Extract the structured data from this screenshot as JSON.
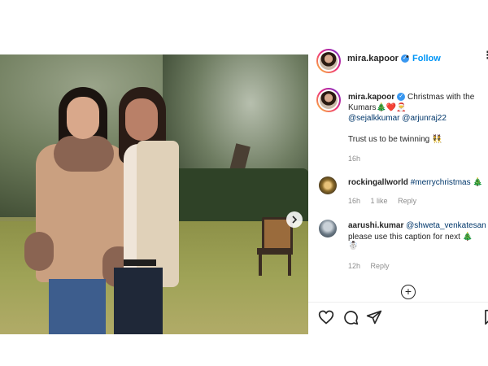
{
  "post": {
    "username": "mira.kapoor",
    "follow_label": "Follow",
    "separator": "•"
  },
  "caption": {
    "username": "mira.kapoor",
    "text": "Christmas with the Kumars",
    "emojis": "🎄❤️🎅",
    "mentions": [
      "@sejalkkumar",
      "@arjunraj22"
    ],
    "line2": "Trust us to be twinning 👯",
    "time": "16h"
  },
  "comments": [
    {
      "username": "rockingallworld",
      "text": "#merrychristmas 🎄",
      "time": "16h",
      "likes": "1 like",
      "reply": "Reply"
    },
    {
      "username": "aarushi.kumar",
      "mention": "@shweta_venkatesan",
      "text": "please use this caption for next 🎄",
      "emoji_line": "☃️",
      "time": "12h",
      "reply": "Reply"
    }
  ],
  "icons": {
    "verified": "verified-badge-icon",
    "more": "more-options-icon",
    "next": "chevron-right-icon",
    "add_comment": "add-comment-icon",
    "like": "heart-icon",
    "comment": "comment-bubble-icon",
    "share": "paper-plane-icon",
    "save": "bookmark-icon"
  },
  "colors": {
    "accent": "#0095f6",
    "link": "#00376b",
    "muted": "#8e8e8e"
  }
}
